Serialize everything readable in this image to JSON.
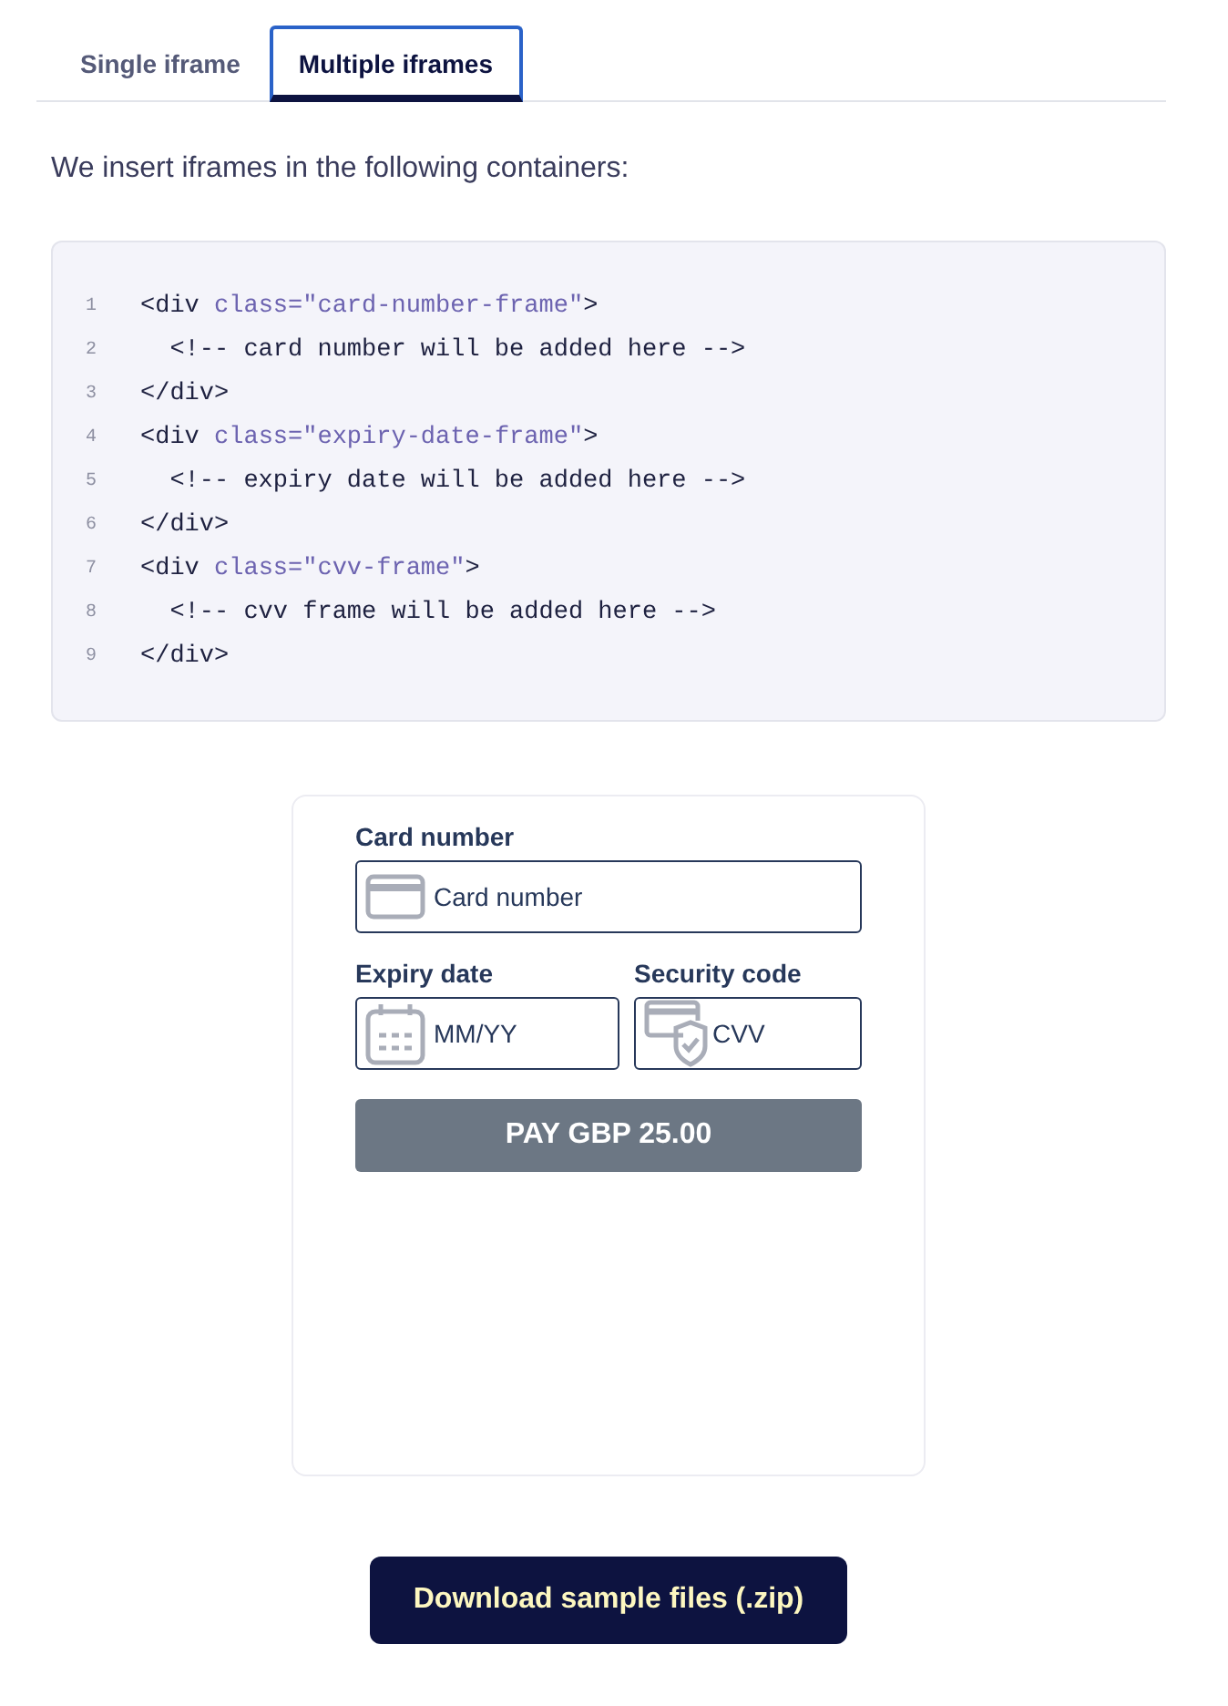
{
  "tabs": [
    {
      "label": "Single iframe",
      "selected": false
    },
    {
      "label": "Multiple iframes",
      "selected": true
    }
  ],
  "intro": "We insert iframes in the following containers:",
  "code": [
    {
      "number": "1",
      "segments": [
        {
          "kind": "plain",
          "text": "<div "
        },
        {
          "kind": "attr",
          "text": "class=\"card-number-frame\""
        },
        {
          "kind": "plain",
          "text": ">"
        }
      ]
    },
    {
      "number": "2",
      "segments": [
        {
          "kind": "plain",
          "text": "  <!-- card number will be added here -->"
        }
      ]
    },
    {
      "number": "3",
      "segments": [
        {
          "kind": "plain",
          "text": "</div>"
        }
      ]
    },
    {
      "number": "4",
      "segments": [
        {
          "kind": "plain",
          "text": "<div "
        },
        {
          "kind": "attr",
          "text": "class=\"expiry-date-frame\""
        },
        {
          "kind": "plain",
          "text": ">"
        }
      ]
    },
    {
      "number": "5",
      "segments": [
        {
          "kind": "plain",
          "text": "  <!-- expiry date will be added here -->"
        }
      ]
    },
    {
      "number": "6",
      "segments": [
        {
          "kind": "plain",
          "text": "</div>"
        }
      ]
    },
    {
      "number": "7",
      "segments": [
        {
          "kind": "plain",
          "text": "<div "
        },
        {
          "kind": "attr",
          "text": "class=\"cvv-frame\""
        },
        {
          "kind": "plain",
          "text": ">"
        }
      ]
    },
    {
      "number": "8",
      "segments": [
        {
          "kind": "plain",
          "text": "  <!-- cvv frame will be added here -->"
        }
      ]
    },
    {
      "number": "9",
      "segments": [
        {
          "kind": "plain",
          "text": "</div>"
        }
      ]
    }
  ],
  "form": {
    "card_number": {
      "label": "Card number",
      "placeholder": "Card number"
    },
    "expiry": {
      "label": "Expiry date",
      "placeholder": "MM/YY"
    },
    "cvv": {
      "label": "Security code",
      "placeholder": "CVV"
    },
    "pay_button": {
      "label": "PAY GBP 25.00",
      "disabled": true
    }
  },
  "download_button": "Download sample files (.zip)"
}
